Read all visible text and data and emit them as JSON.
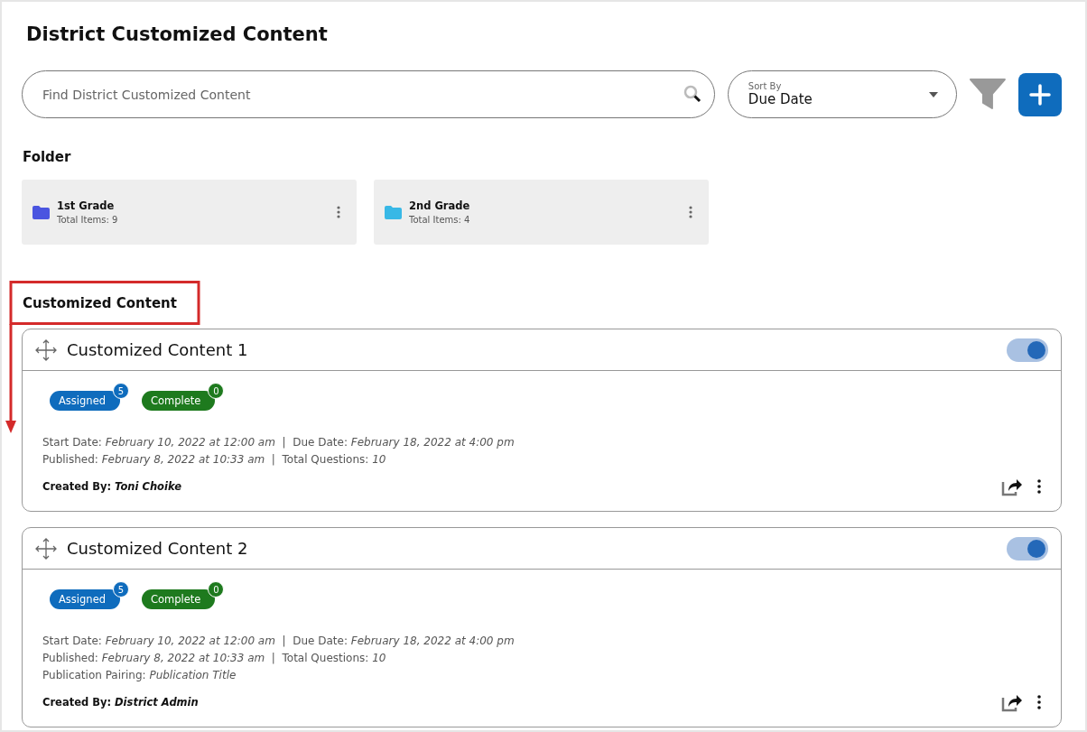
{
  "page_title": "District Customized Content",
  "search": {
    "placeholder": "Find District Customized Content"
  },
  "sort": {
    "label": "Sort By",
    "value": "Due Date"
  },
  "folders_heading": "Folder",
  "folders": [
    {
      "name": "1st Grade",
      "count": "Total Items: 9",
      "color": "#4a55e0"
    },
    {
      "name": "2nd Grade",
      "count": "Total Items: 4",
      "color": "#38b8e6"
    }
  ],
  "section": {
    "heading": "Customized Content",
    "highlighted": true
  },
  "items": [
    {
      "title": "Customized Content 1",
      "on": true,
      "badges": [
        {
          "label": "Assigned",
          "count": "5",
          "color": "#0f6cbd"
        },
        {
          "label": "Complete",
          "count": "0",
          "color": "#1e7a1e"
        }
      ],
      "lines": [
        "Start Date: *February 10, 2022 at 12:00 am*  |  Due Date: *February 18, 2022 at 4:00 pm*",
        "Published: *February 8, 2022 at 10:33 am*  |  Total Questions: *10*"
      ],
      "created_by": "Created By: *Toni Choike*"
    },
    {
      "title": "Customized Content 2",
      "on": true,
      "badges": [
        {
          "label": "Assigned",
          "count": "5",
          "color": "#0f6cbd"
        },
        {
          "label": "Complete",
          "count": "0",
          "color": "#1e7a1e"
        }
      ],
      "lines": [
        "Start Date: *February 10, 2022 at 12:00 am*  |  Due Date: *February 18, 2022 at 4:00 pm*",
        "Published: *February 8, 2022 at 10:33 am*  |  Total Questions: *10*",
        "Publication Pairing: *Publication Title*"
      ],
      "created_by": "Created By: *District Admin*"
    }
  ]
}
